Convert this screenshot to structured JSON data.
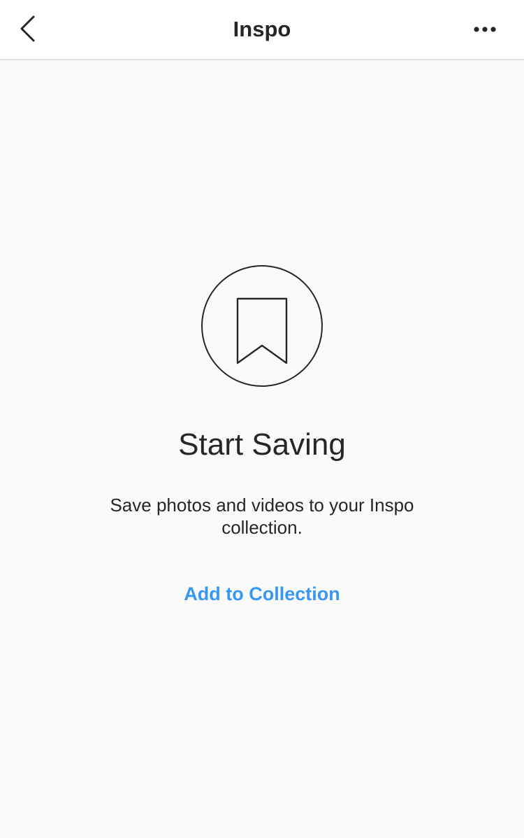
{
  "header": {
    "title": "Inspo",
    "back_icon": "chevron-left-icon",
    "more_icon": "more-horizontal-icon"
  },
  "empty_state": {
    "icon": "bookmark-icon",
    "heading": "Start Saving",
    "description": "Save photos and videos to your Inspo collection.",
    "action_label": "Add to Collection"
  },
  "colors": {
    "background": "#fafafa",
    "header_background": "#ffffff",
    "text": "#262626",
    "link": "#3897f0",
    "divider": "#cfcfcf"
  }
}
